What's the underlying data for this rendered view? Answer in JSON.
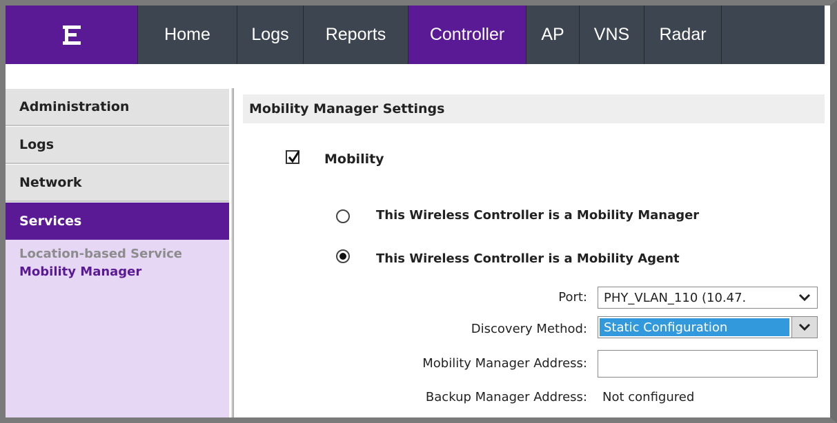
{
  "nav": {
    "tabs": [
      {
        "label": "Home"
      },
      {
        "label": "Logs"
      },
      {
        "label": "Reports"
      },
      {
        "label": "Controller"
      },
      {
        "label": "AP"
      },
      {
        "label": "VNS"
      },
      {
        "label": "Radar"
      }
    ],
    "active_tab": "Controller",
    "brand_color": "#5a1a96",
    "bar_color": "#3d4550"
  },
  "sidebar": {
    "sections": [
      {
        "label": "Administration"
      },
      {
        "label": "Logs"
      },
      {
        "label": "Network"
      },
      {
        "label": "Services"
      }
    ],
    "active_section": "Services",
    "links": [
      {
        "label": "Location-based Service"
      },
      {
        "label": "Mobility Manager"
      }
    ],
    "selected_link": "Mobility Manager"
  },
  "main": {
    "title": "Mobility Manager Settings",
    "mobility": {
      "label": "Mobility",
      "checked": true
    },
    "role_options": [
      {
        "label": "This Wireless Controller is a Mobility Manager",
        "selected": false
      },
      {
        "label": "This Wireless Controller is a Mobility Agent",
        "selected": true
      }
    ],
    "port": {
      "label": "Port:",
      "value": "PHY_VLAN_110 (10.47."
    },
    "discovery": {
      "label": "Discovery Method:",
      "value": "Static Configuration",
      "highlight_color": "#3399dd"
    },
    "mobility_manager_address": {
      "label": "Mobility Manager Address:",
      "value": ""
    },
    "backup_manager_address": {
      "label": "Backup Manager Address:",
      "value": "Not configured"
    }
  }
}
